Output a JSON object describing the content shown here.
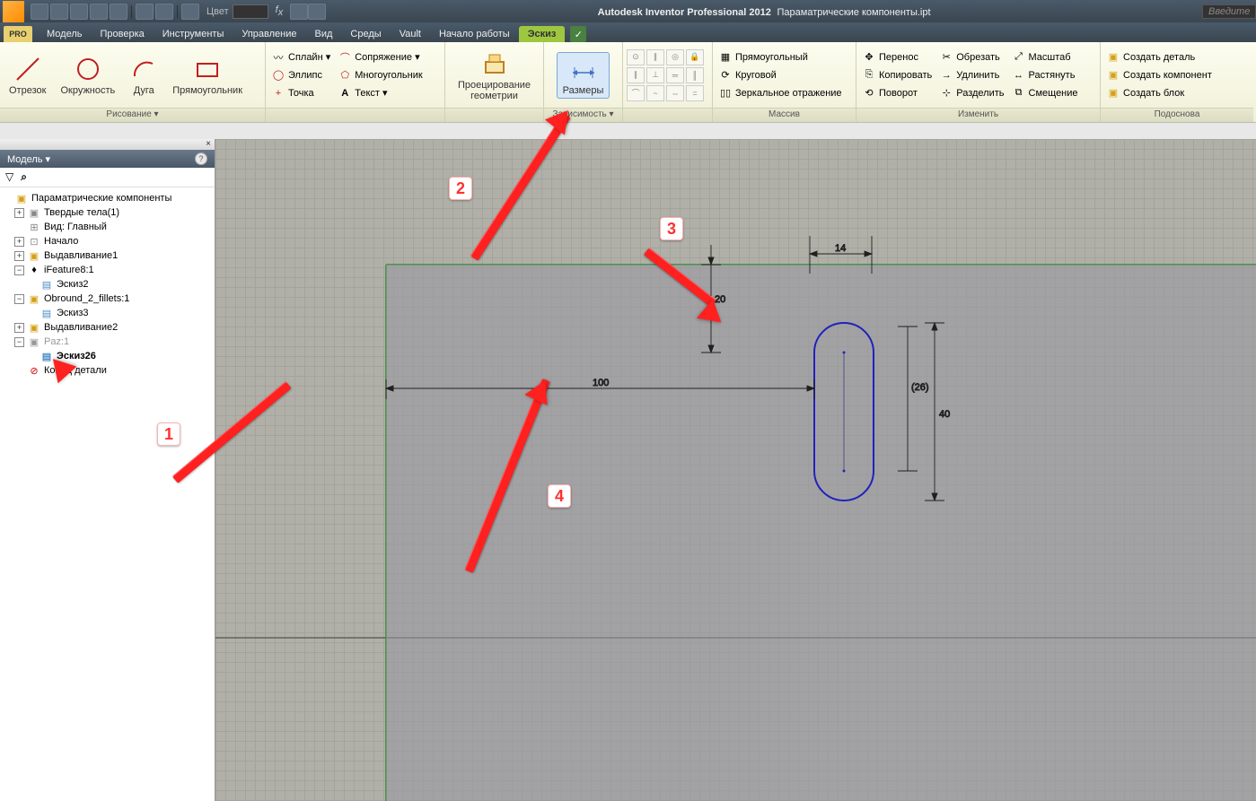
{
  "title": {
    "app": "Autodesk Inventor Professional 2012",
    "file": "Параматрические компоненты.ipt"
  },
  "qat_color_label": "Цвет",
  "search_placeholder": "Введите",
  "tabs": {
    "pro": "PRO",
    "items": [
      "Модель",
      "Проверка",
      "Инструменты",
      "Управление",
      "Вид",
      "Среды",
      "Vault",
      "Начало работы",
      "Эскиз"
    ],
    "active": 8
  },
  "ribbon": {
    "draw": {
      "label": "Рисование ▾",
      "line": "Отрезок",
      "circle": "Окружность",
      "arc": "Дуга",
      "rect": "Прямоугольник",
      "spline": "Сплайн ▾",
      "fillet": "Сопряжение ▾",
      "ellipse": "Эллипс",
      "polygon": "Многоугольник",
      "point": "Точка",
      "text": "Текст ▾"
    },
    "project": {
      "top": "Проецирование",
      "bot": "геометрии"
    },
    "dimension": {
      "label": "Размеры"
    },
    "constrain": {
      "label": "Зависимость ▾"
    },
    "array": {
      "label": "Массив",
      "rect": "Прямоугольный",
      "circ": "Круговой",
      "mirror": "Зеркальное отражение"
    },
    "modify": {
      "label": "Изменить",
      "move": "Перенос",
      "trim": "Обрезать",
      "scale": "Масштаб",
      "copy": "Копировать",
      "extend": "Удлинить",
      "stretch": "Растянуть",
      "rotate": "Поворот",
      "split": "Разделить",
      "offset": "Смещение"
    },
    "create": {
      "label": "Подоснова",
      "part": "Создать деталь",
      "comp": "Создать компонент",
      "block": "Создать блок"
    }
  },
  "browser": {
    "header": "Модель ▾",
    "root": "Параматрические компоненты",
    "bodies": "Твердые тела(1)",
    "view": "Вид: Главный",
    "origin": "Начало",
    "extrude1": "Выдавливание1",
    "ifeat": "iFeature8:1",
    "sketch2": "Эскиз2",
    "obround": "Obround_2_fillets:1",
    "sketch3": "Эскиз3",
    "extrude2": "Выдавливание2",
    "paz": "Paz:1",
    "sketch26": "Эскиз26",
    "end": "Конец детали"
  },
  "dims": {
    "d14": "14",
    "d20": "20",
    "d100": "100",
    "d26": "(26)",
    "d40": "40"
  },
  "annotations": {
    "n1": "1",
    "n2": "2",
    "n3": "3",
    "n4": "4"
  }
}
